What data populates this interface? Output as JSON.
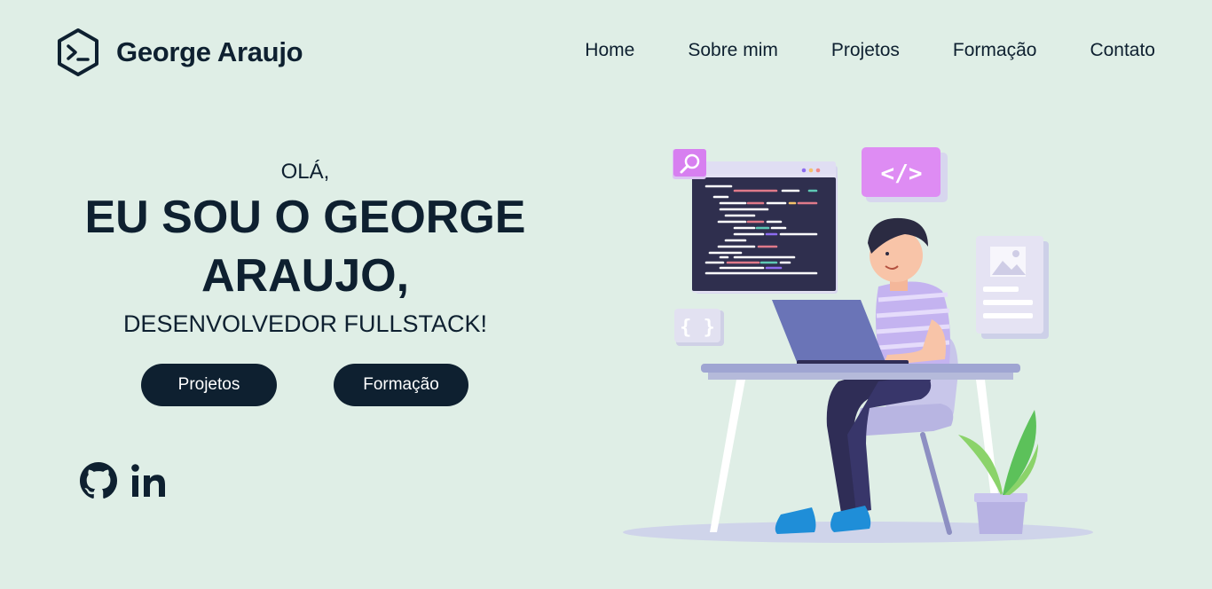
{
  "brand": {
    "name": "George Araujo",
    "icon": "terminal-hexagon-icon"
  },
  "nav": {
    "items": [
      {
        "label": "Home"
      },
      {
        "label": "Sobre mim"
      },
      {
        "label": "Projetos"
      },
      {
        "label": "Formação"
      },
      {
        "label": "Contato"
      }
    ]
  },
  "hero": {
    "greeting": "OLÁ,",
    "headline_line1": "EU SOU O GEORGE",
    "headline_line2": "ARAUJO,",
    "subtitle": "DESENVOLVEDOR FULLSTACK!"
  },
  "buttons": {
    "projetos": "Projetos",
    "formacao": "Formação"
  },
  "socials": [
    {
      "icon": "github-icon"
    },
    {
      "icon": "linkedin-icon"
    }
  ],
  "colors": {
    "background": "#dfeee6",
    "primary": "#0e2030",
    "button_text": "#ffffff",
    "accent_purple": "#c78df2"
  }
}
